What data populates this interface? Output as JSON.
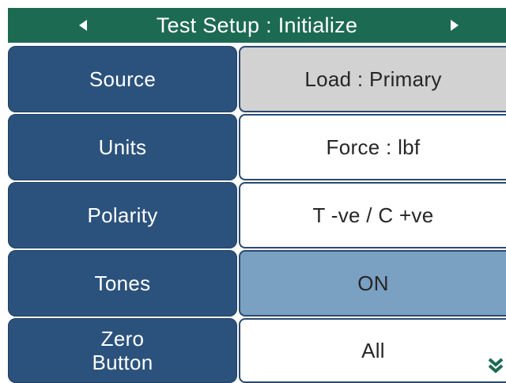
{
  "header": {
    "title": "Test Setup : Initialize",
    "prev_icon": "triangle-left-icon",
    "next_icon": "triangle-right-icon"
  },
  "rows": [
    {
      "label": "Source",
      "value": "Load : Primary",
      "state": "grey"
    },
    {
      "label": "Units",
      "value": "Force : lbf",
      "state": "white"
    },
    {
      "label": "Polarity",
      "value": "T -ve / C +ve",
      "state": "white"
    },
    {
      "label": "Tones",
      "value": "ON",
      "state": "blue"
    },
    {
      "label_line1": "Zero",
      "label_line2": "Button",
      "value": "All",
      "state": "white"
    }
  ],
  "scroll_icon": "double-chevron-down-icon",
  "colors": {
    "header_bg": "#1d6a52",
    "label_bg": "#2b527c",
    "value_grey": "#d2d2d2",
    "value_blue": "#7aa0c2",
    "scroll_icon": "#1d6a52"
  }
}
